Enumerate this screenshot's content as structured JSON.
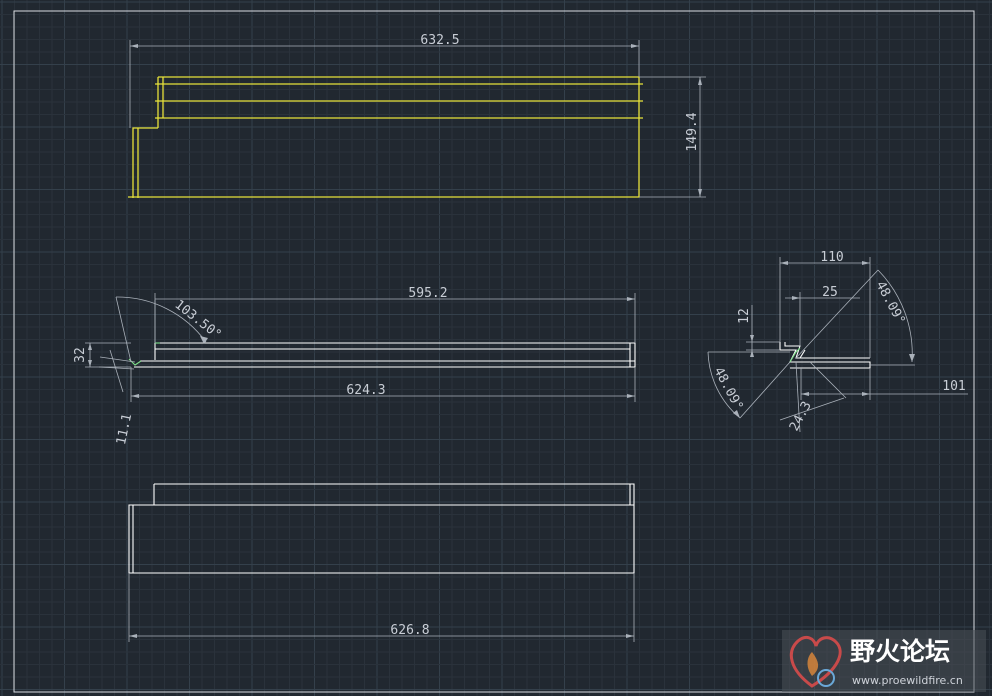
{
  "colors": {
    "background": "#212830",
    "grid_minor": "#2a323b",
    "grid_major": "#34404b",
    "frame": "#d9dde2",
    "geometry_primary": "#e7e23a",
    "geometry_secondary": "#ffffff",
    "dimension": "#aab1ba",
    "accent": "#7fe08a"
  },
  "views": {
    "top_view": {
      "width_dim": "632.5",
      "height_dim": "149.4"
    },
    "front_view": {
      "inner_length_dim": "595.2",
      "outer_length_dim": "624.3",
      "angle_dim": "103.50°",
      "height_dim": "32",
      "offset_dim": "11.1"
    },
    "detail_view": {
      "total_width_dim": "110",
      "inner_width_dim": "25",
      "flange_height_dim": "12",
      "angle_right_dim": "48.09°",
      "angle_left_dim": "48.09°",
      "extension_dim": "101",
      "slant_length_dim": "24.3"
    },
    "bottom_view": {
      "length_dim": "626.8"
    }
  },
  "watermark": {
    "brand_text": "野火论坛",
    "url_text": "www.proewildfire.cn",
    "logo_icon": "flame-heart-logo-icon"
  }
}
